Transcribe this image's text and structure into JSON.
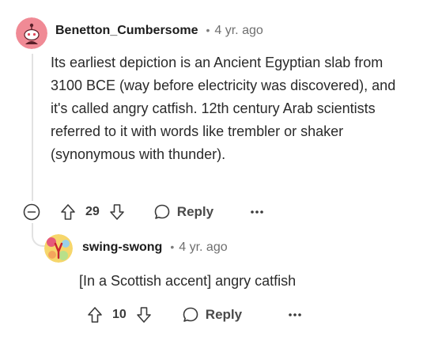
{
  "comments": [
    {
      "username": "Benetton_Cumbersome",
      "separator": "•",
      "age": "4 yr. ago",
      "body": "Its earliest depiction is an Ancient Egyptian slab from 3100 BCE (way before electricity was discovered), and it's called angry catfish. 12th century Arab scientists referred to it with words like trembler or shaker (synonymous with thunder).",
      "votes": "29",
      "reply_label": "Reply",
      "avatar_color": "#ef7f8a"
    },
    {
      "username": "swing-swong",
      "separator": "•",
      "age": "4 yr. ago",
      "body": "[In a Scottish accent] angry catfish",
      "votes": "10",
      "reply_label": "Reply",
      "avatar_color": "#f6d66b"
    }
  ],
  "icons": {
    "collapse": "minus-circle-icon",
    "upvote": "arrow-up-icon",
    "downvote": "arrow-down-icon",
    "reply": "speech-bubble-icon",
    "more": "more-dots-icon"
  }
}
